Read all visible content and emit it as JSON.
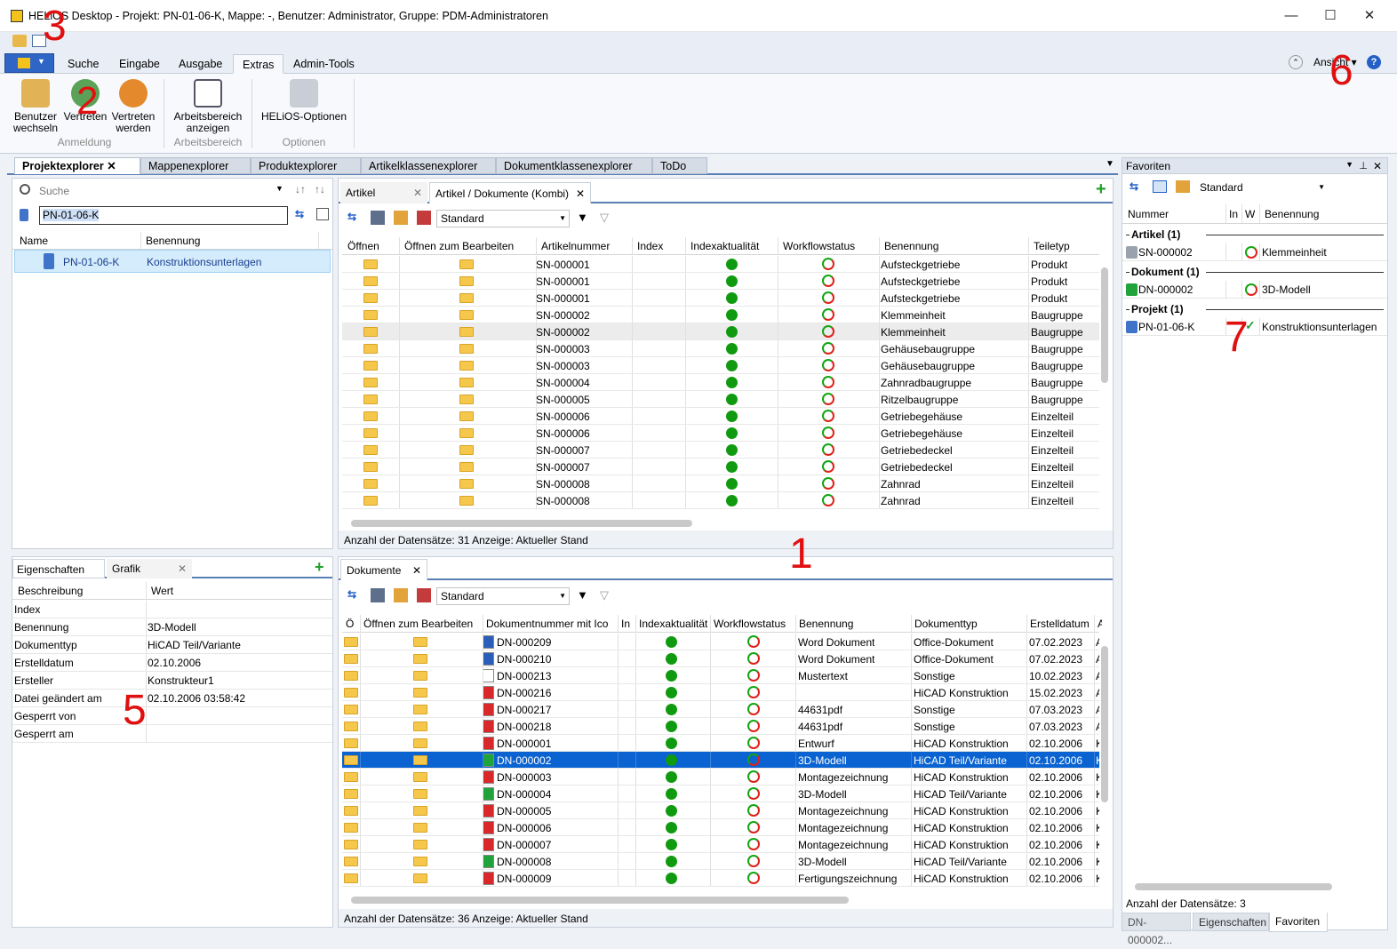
{
  "window": {
    "title": "HELiOS Desktop - Projekt: PN-01-06-K, Mappe: -, Benutzer: Administrator, Gruppe: PDM-Administratoren",
    "minimize": "—",
    "maximize": "☐",
    "close": "✕"
  },
  "ribbon": {
    "tabs": [
      "Suche",
      "Eingabe",
      "Ausgabe",
      "Extras",
      "Admin-Tools"
    ],
    "active_tab": "Extras",
    "right": {
      "ansicht": "Ansicht ▾",
      "help": "?"
    },
    "groups": [
      {
        "label": "Anmeldung",
        "buttons": [
          "Benutzer\nwechseln",
          "Vertreten",
          "Vertreten\nwerden"
        ]
      },
      {
        "label": "Arbeitsbereich",
        "buttons": [
          "Arbeitsbereich\nanzeigen"
        ]
      },
      {
        "label": "Optionen",
        "buttons": [
          "HELiOS-Optionen"
        ]
      }
    ]
  },
  "overlays": {
    "n1": "1",
    "n2": "2",
    "n3": "3",
    "n5": "5",
    "n6": "6",
    "n7": "7"
  },
  "explorer_tabs": [
    "Projektexplorer",
    "Mappenexplorer",
    "Produktexplorer",
    "Artikelklassenexplorer",
    "Dokumentklassenexplorer",
    "ToDo"
  ],
  "left": {
    "search_placeholder": "Suche",
    "project_input": "PN-01-06-K",
    "columns": [
      "Name",
      "Benennung"
    ],
    "rows": [
      {
        "name": "PN-01-06-K",
        "benennung": "Konstruktionsunterlagen"
      }
    ]
  },
  "props": {
    "tabs": [
      "Eigenschaften",
      "Grafik"
    ],
    "columns": [
      "Beschreibung",
      "Wert"
    ],
    "rows": [
      {
        "k": "Index",
        "v": ""
      },
      {
        "k": "Benennung",
        "v": "3D-Modell"
      },
      {
        "k": "Dokumenttyp",
        "v": "HiCAD Teil/Variante"
      },
      {
        "k": "Erstelldatum",
        "v": "02.10.2006"
      },
      {
        "k": "Ersteller",
        "v": "Konstrukteur1"
      },
      {
        "k": "Datei geändert am",
        "v": "02.10.2006 03:58:42"
      },
      {
        "k": "Gesperrt von",
        "v": ""
      },
      {
        "k": "Gesperrt am",
        "v": ""
      }
    ]
  },
  "articles": {
    "tabs": [
      "Artikel",
      "Artikel / Dokumente (Kombi)"
    ],
    "view": "Standard",
    "columns": [
      "Öffnen",
      "Öffnen zum Bearbeiten",
      "Artikelnummer",
      "Index",
      "Indexaktualität",
      "Workflowstatus",
      "Benennung",
      "Teiletyp"
    ],
    "rows": [
      {
        "nr": "SN-000001",
        "ben": "Aufsteckgetriebe",
        "typ": "Produkt"
      },
      {
        "nr": "SN-000001",
        "ben": "Aufsteckgetriebe",
        "typ": "Produkt"
      },
      {
        "nr": "SN-000001",
        "ben": "Aufsteckgetriebe",
        "typ": "Produkt"
      },
      {
        "nr": "SN-000002",
        "ben": "Klemmeinheit",
        "typ": "Baugruppe"
      },
      {
        "nr": "SN-000002",
        "ben": "Klemmeinheit",
        "typ": "Baugruppe"
      },
      {
        "nr": "SN-000003",
        "ben": "Gehäusebaugruppe",
        "typ": "Baugruppe"
      },
      {
        "nr": "SN-000003",
        "ben": "Gehäusebaugruppe",
        "typ": "Baugruppe"
      },
      {
        "nr": "SN-000004",
        "ben": "Zahnradbaugruppe",
        "typ": "Baugruppe"
      },
      {
        "nr": "SN-000005",
        "ben": "Ritzelbaugruppe",
        "typ": "Baugruppe"
      },
      {
        "nr": "SN-000006",
        "ben": "Getriebegehäuse",
        "typ": "Einzelteil"
      },
      {
        "nr": "SN-000006",
        "ben": "Getriebegehäuse",
        "typ": "Einzelteil"
      },
      {
        "nr": "SN-000007",
        "ben": "Getriebedeckel",
        "typ": "Einzelteil"
      },
      {
        "nr": "SN-000007",
        "ben": "Getriebedeckel",
        "typ": "Einzelteil"
      },
      {
        "nr": "SN-000008",
        "ben": "Zahnrad",
        "typ": "Einzelteil"
      },
      {
        "nr": "SN-000008",
        "ben": "Zahnrad",
        "typ": "Einzelteil"
      }
    ],
    "status": "Anzahl der Datensätze: 31   Anzeige: Aktueller Stand"
  },
  "documents": {
    "tab": "Dokumente",
    "view": "Standard",
    "columns": [
      "Ö",
      "Öffnen zum Bearbeiten",
      "Dokumentnummer mit Ico",
      "In",
      "Indexaktualität",
      "Workflowstatus",
      "Benennung",
      "Dokumenttyp",
      "Erstelldatum",
      "A"
    ],
    "rows": [
      {
        "nr": "DN-000209",
        "ben": "Word Dokument",
        "typ": "Office-Dokument",
        "dat": "07.02.2023",
        "a": "A",
        "ic": "word"
      },
      {
        "nr": "DN-000210",
        "ben": "Word Dokument",
        "typ": "Office-Dokument",
        "dat": "07.02.2023",
        "a": "A",
        "ic": "word"
      },
      {
        "nr": "DN-000213",
        "ben": "Mustertext",
        "typ": "Sonstige",
        "dat": "10.02.2023",
        "a": "A",
        "ic": "txt"
      },
      {
        "nr": "DN-000216",
        "ben": "",
        "typ": "HiCAD Konstruktion",
        "dat": "15.02.2023",
        "a": "A",
        "ic": "cad"
      },
      {
        "nr": "DN-000217",
        "ben": "44631pdf",
        "typ": "Sonstige",
        "dat": "07.03.2023",
        "a": "A",
        "ic": "pdf"
      },
      {
        "nr": "DN-000218",
        "ben": "44631pdf",
        "typ": "Sonstige",
        "dat": "07.03.2023",
        "a": "A",
        "ic": "pdf"
      },
      {
        "nr": "DN-000001",
        "ben": "Entwurf",
        "typ": "HiCAD Konstruktion",
        "dat": "02.10.2006",
        "a": "K",
        "ic": "cad"
      },
      {
        "nr": "DN-000002",
        "ben": "3D-Modell",
        "typ": "HiCAD Teil/Variante",
        "dat": "02.10.2006",
        "a": "K",
        "ic": "cad3d",
        "sel": true
      },
      {
        "nr": "DN-000003",
        "ben": "Montagezeichnung",
        "typ": "HiCAD Konstruktion",
        "dat": "02.10.2006",
        "a": "K",
        "ic": "cad"
      },
      {
        "nr": "DN-000004",
        "ben": "3D-Modell",
        "typ": "HiCAD Teil/Variante",
        "dat": "02.10.2006",
        "a": "K",
        "ic": "cad3d"
      },
      {
        "nr": "DN-000005",
        "ben": "Montagezeichnung",
        "typ": "HiCAD Konstruktion",
        "dat": "02.10.2006",
        "a": "K",
        "ic": "cad"
      },
      {
        "nr": "DN-000006",
        "ben": "Montagezeichnung",
        "typ": "HiCAD Konstruktion",
        "dat": "02.10.2006",
        "a": "K",
        "ic": "cad"
      },
      {
        "nr": "DN-000007",
        "ben": "Montagezeichnung",
        "typ": "HiCAD Konstruktion",
        "dat": "02.10.2006",
        "a": "K",
        "ic": "cad"
      },
      {
        "nr": "DN-000008",
        "ben": "3D-Modell",
        "typ": "HiCAD Teil/Variante",
        "dat": "02.10.2006",
        "a": "K",
        "ic": "cad3d"
      },
      {
        "nr": "DN-000009",
        "ben": "Fertigungszeichnung",
        "typ": "HiCAD Konstruktion",
        "dat": "02.10.2006",
        "a": "K",
        "ic": "cad"
      }
    ],
    "status": "Anzahl der Datensätze: 36   Anzeige: Aktueller Stand"
  },
  "favorites": {
    "title": "Favoriten",
    "view": "Standard",
    "columns": [
      "Nummer",
      "In",
      "W",
      "Benennung"
    ],
    "sections": [
      {
        "label": "Artikel (1)",
        "nr": "SN-000002",
        "ben": "Klemmeinheit"
      },
      {
        "label": "Dokument (1)",
        "nr": "DN-000002",
        "ben": "3D-Modell"
      },
      {
        "label": "Projekt (1)",
        "nr": "PN-01-06-K",
        "ben": "Konstruktionsunterlagen"
      }
    ],
    "status": "Anzahl der Datensätze: 3",
    "bottom_tabs": [
      "DN-000002...",
      "Eigenschaften",
      "Favoriten"
    ]
  },
  "colors": {
    "accent": "#0a63d1",
    "ok": "#109a10",
    "overlay": "#e01010"
  }
}
